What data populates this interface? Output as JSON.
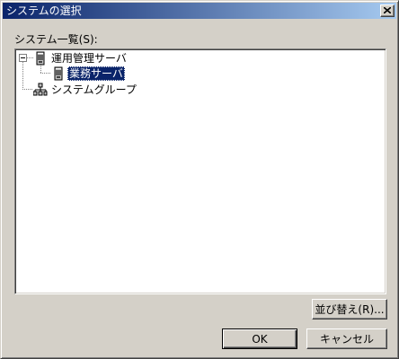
{
  "window": {
    "title": "システムの選択"
  },
  "list": {
    "label": "システム一覧(S):",
    "nodes": [
      {
        "label": "運用管理サーバ",
        "icon": "server-icon",
        "expanded": true
      },
      {
        "label": "業務サーバ",
        "icon": "server-icon",
        "selected": true
      },
      {
        "label": "システムグループ",
        "icon": "network-group-icon"
      }
    ]
  },
  "buttons": {
    "sort": "並び替え(R)...",
    "ok": "OK",
    "cancel": "キャンセル"
  }
}
